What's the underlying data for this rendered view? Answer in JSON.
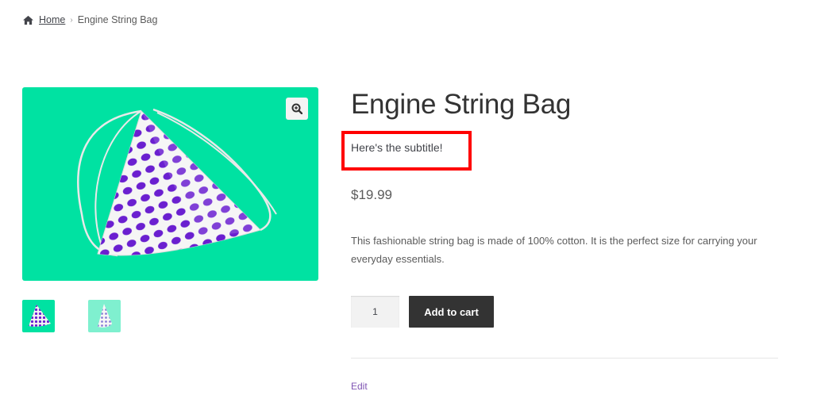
{
  "breadcrumb": {
    "home_label": "Home",
    "current": "Engine String Bag"
  },
  "gallery": {
    "main_image_icon": "drawstring-bag-image",
    "zoom_icon": "magnifier-zoom-icon",
    "thumbnails": [
      "drawstring-bag-thumbnail",
      "drawstring-bag-thumbnail-alt"
    ],
    "background_color": "#00e2a2"
  },
  "product": {
    "title": "Engine String Bag",
    "subtitle": "Here's the subtitle!",
    "price": "$19.99",
    "description": "This fashionable string bag is made of 100% cotton. It is the perfect size for carrying your everyday essentials."
  },
  "cart": {
    "quantity": "1",
    "add_to_cart_label": "Add to cart"
  },
  "admin": {
    "edit_label": "Edit"
  },
  "colors": {
    "accent_box": "#ff0000",
    "button_bg": "#333333",
    "link": "#7f54b3"
  }
}
